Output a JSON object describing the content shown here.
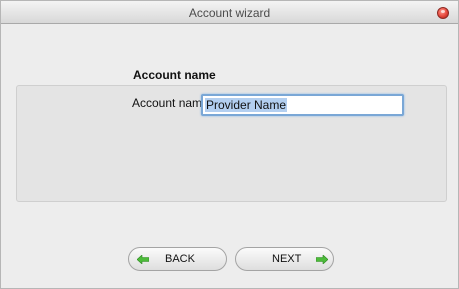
{
  "window": {
    "title": "Account wizard"
  },
  "section": {
    "title": "Account name"
  },
  "form": {
    "account_name_label": "Account name",
    "account_name_value": "Provider Name"
  },
  "buttons": {
    "back_label": "BACK",
    "next_label": "NEXT"
  },
  "colors": {
    "arrow_green": "#4dbb3a",
    "focus_blue": "#7aa7d6",
    "selection": "#b3cff0",
    "close_red": "#e5473c"
  },
  "icons": {
    "back": "left-arrow-icon",
    "next": "right-arrow-icon",
    "close": "close-icon"
  }
}
